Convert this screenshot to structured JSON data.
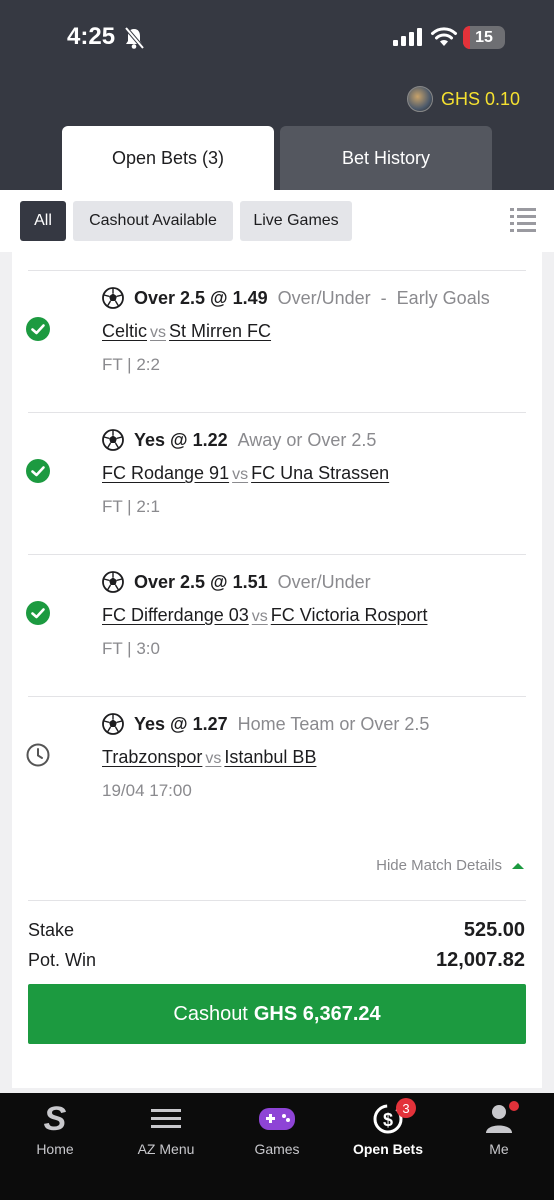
{
  "status_bar": {
    "time": "4:25",
    "battery": "15"
  },
  "header": {
    "balance": "GHS 0.10"
  },
  "tabs": [
    {
      "label": "Open Bets (3)",
      "active": true
    },
    {
      "label": "Bet History",
      "active": false
    }
  ],
  "filters": [
    {
      "label": "All",
      "active": true
    },
    {
      "label": "Cashout Available",
      "active": false
    },
    {
      "label": "Live Games",
      "active": false
    }
  ],
  "bets": [
    {
      "pick": "Over 2.5 @ 1.49",
      "market": "Over/Under  -  Early Goals",
      "home": "Celtic",
      "away": "St Mirren FC",
      "result": "FT | 2:2",
      "status": "won"
    },
    {
      "pick": "Yes @ 1.22",
      "market": "Away or Over 2.5",
      "home": "FC Rodange 91",
      "away": "FC Una Strassen",
      "result": "FT | 2:1",
      "status": "won"
    },
    {
      "pick": "Over 2.5 @ 1.51",
      "market": "Over/Under",
      "home": "FC Differdange 03",
      "away": "FC Victoria Rosport",
      "result": "FT | 3:0",
      "status": "won"
    },
    {
      "pick": "Yes @ 1.27",
      "market": "Home Team or Over 2.5",
      "home": "Trabzonspor",
      "away": "Istanbul BB",
      "result": "19/04 17:00",
      "status": "pending"
    }
  ],
  "vs_label": "vs",
  "hide_details": "Hide Match Details",
  "summary": {
    "stake_label": "Stake",
    "stake_value": "525.00",
    "potwin_label": "Pot. Win",
    "potwin_value": "12,007.82"
  },
  "cashout": {
    "prefix": "Cashout",
    "amount": "GHS 6,367.24"
  },
  "nav": [
    {
      "label": "Home",
      "icon": "sportybet-logo-icon"
    },
    {
      "label": "AZ Menu",
      "icon": "menu-icon"
    },
    {
      "label": "Games",
      "icon": "gamepad-icon"
    },
    {
      "label": "Open Bets",
      "icon": "open-bets-icon",
      "badge": "3",
      "active": true
    },
    {
      "label": "Me",
      "icon": "user-icon"
    }
  ],
  "colors": {
    "header": "#363942",
    "accent_green": "#1c9a40",
    "balance": "#f5e130",
    "badge": "#e3323a"
  }
}
